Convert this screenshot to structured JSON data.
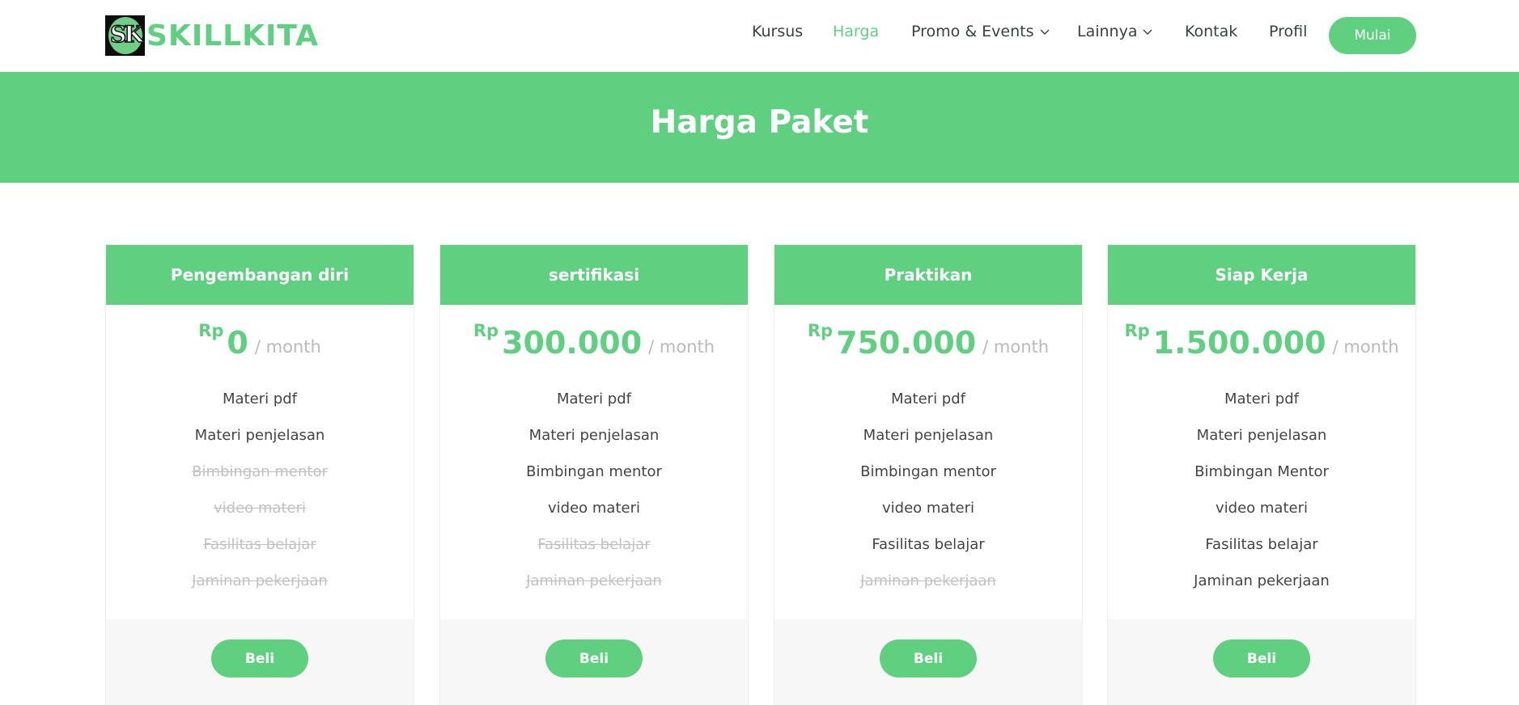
{
  "brand": {
    "logo_letters": "SK",
    "name": "SKILLKITA"
  },
  "nav": {
    "items": [
      {
        "label": "Kursus"
      },
      {
        "label": "Harga"
      },
      {
        "label": "Promo & Events"
      },
      {
        "label": "Lainnya"
      },
      {
        "label": "Kontak"
      },
      {
        "label": "Profil"
      }
    ],
    "active": "Harga",
    "cta_label": "Mulai"
  },
  "banner": {
    "title": "Harga Paket"
  },
  "colors": {
    "accent": "#5fcf80",
    "text": "#444444",
    "muted": "#c1c1c1",
    "footer_bg": "#f7f7f7"
  },
  "plans": [
    {
      "name": "Pengembangan diri",
      "currency": "Rp",
      "price": "0",
      "period": "/ month",
      "features": [
        {
          "label": "Materi pdf",
          "included": true
        },
        {
          "label": "Materi penjelasan",
          "included": true
        },
        {
          "label": "Bimbingan mentor",
          "included": false
        },
        {
          "label": "video materi",
          "included": false
        },
        {
          "label": "Fasilitas belajar",
          "included": false
        },
        {
          "label": "Jaminan pekerjaan",
          "included": false
        }
      ],
      "button_label": "Beli"
    },
    {
      "name": "sertifikasi",
      "currency": "Rp",
      "price": "300.000",
      "period": "/ month",
      "features": [
        {
          "label": "Materi pdf",
          "included": true
        },
        {
          "label": "Materi penjelasan",
          "included": true
        },
        {
          "label": "Bimbingan mentor",
          "included": true
        },
        {
          "label": "video materi",
          "included": true
        },
        {
          "label": "Fasilitas belajar",
          "included": false
        },
        {
          "label": "Jaminan pekerjaan",
          "included": false
        }
      ],
      "button_label": "Beli"
    },
    {
      "name": "Praktikan",
      "currency": "Rp",
      "price": "750.000",
      "period": "/ month",
      "features": [
        {
          "label": "Materi pdf",
          "included": true
        },
        {
          "label": "Materi penjelasan",
          "included": true
        },
        {
          "label": "Bimbingan mentor",
          "included": true
        },
        {
          "label": "video materi",
          "included": true
        },
        {
          "label": "Fasilitas belajar",
          "included": true
        },
        {
          "label": "Jaminan pekerjaan",
          "included": false
        }
      ],
      "button_label": "Beli"
    },
    {
      "name": "Siap Kerja",
      "currency": "Rp",
      "price": "1.500.000",
      "period": "/ month",
      "features": [
        {
          "label": "Materi pdf",
          "included": true
        },
        {
          "label": "Materi penjelasan",
          "included": true
        },
        {
          "label": "Bimbingan Mentor",
          "included": true
        },
        {
          "label": "video materi",
          "included": true
        },
        {
          "label": "Fasilitas belajar",
          "included": true
        },
        {
          "label": "Jaminan pekerjaan",
          "included": true
        }
      ],
      "button_label": "Beli"
    }
  ]
}
